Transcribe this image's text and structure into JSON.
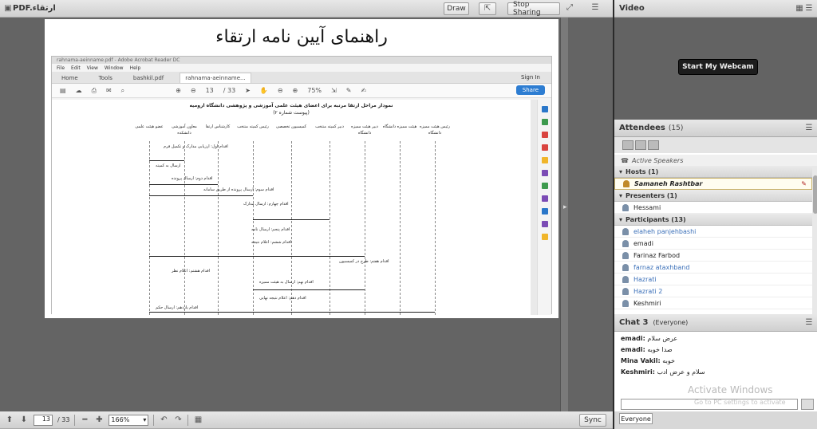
{
  "share": {
    "title": "PDF.ارتقاء",
    "draw_label": "Draw",
    "stop_label": "Stop Sharing",
    "slide_title": "راهنمای آیین نامه ارتقاء"
  },
  "reader": {
    "window_title": "rahnama-aeinname.pdf - Adobe Acrobat Reader DC",
    "menu": [
      "File",
      "Edit",
      "View",
      "Window",
      "Help"
    ],
    "tabs": [
      "Home",
      "Tools",
      "bashkil.pdf",
      "rahnama-aeinname..."
    ],
    "signin": "Sign In",
    "share_label": "Share",
    "page_current": "13",
    "page_total": "/ 33",
    "zoom": "75%",
    "doc_title": "نمودار مراحل ارتقا مرتبه برای اعضای هیئت علمی آموزشی و پژوهشی دانشگاه ارومیه",
    "doc_subtitle": "(پیوست شماره ۲)",
    "lanes": [
      "رئیس هیئت ممیزه دانشگاه",
      "هیئت ممیزه دانشگاه",
      "دبیر هیئت ممیزه دانشگاه",
      "دبیر کمیته منتخب",
      "کمیسیون تخصصی",
      "رئیس کمیته منتخب",
      "کارشناس ارتقا",
      "معاون آموزشی دانشکده",
      "عضو هیئت علمی"
    ],
    "steps": [
      "اقدام اول: ارزیابی مدارک و تکمیل فرم",
      "ارسال به کمیته",
      "اقدام دوم: ارسال پرونده",
      "اقدام سوم: ارسال پرونده از طریق سامانه",
      "اقدام چهارم: ارسال مدارک",
      "اقدام پنجم: ارسال نامه",
      "اقدام ششم: اعلام نتیجه",
      "اقدام هفتم: طرح در کمیسیون",
      "اقدام هشتم: اعلام نظر",
      "اقدام نهم: ارسال به هیئت ممیزه",
      "اقدام دهم: اعلام نتیجه نهایی",
      "اقدام یازدهم: ارسال حکم"
    ]
  },
  "bottom": {
    "page_value": "13",
    "page_total": "/ 33",
    "zoom_value": "166%",
    "sync_label": "Sync"
  },
  "video": {
    "title": "Video",
    "webcam_label": "Start My Webcam"
  },
  "attendees": {
    "title": "Attendees",
    "count": "(15)",
    "active_speakers": "Active Speakers",
    "hosts_label": "Hosts (1)",
    "hosts": [
      "Samaneh Rashtbar"
    ],
    "presenters_label": "Presenters (1)",
    "presenters": [
      "Hessami"
    ],
    "participants_label": "Participants (13)",
    "participants": [
      {
        "name": "elaheh panjehbashi",
        "blue": true
      },
      {
        "name": "emadi",
        "blue": false
      },
      {
        "name": "Farinaz Farbod",
        "blue": false
      },
      {
        "name": "farnaz ataxhband",
        "blue": true
      },
      {
        "name": "Hazrati",
        "blue": true
      },
      {
        "name": "Hazrati 2",
        "blue": true
      },
      {
        "name": "Keshmiri",
        "blue": false
      }
    ]
  },
  "chat": {
    "title": "Chat 3",
    "scope": "(Everyone)",
    "messages": [
      {
        "sender": "emadi:",
        "text": "عرض سلام"
      },
      {
        "sender": "emadi:",
        "text": "صدا خوبه"
      },
      {
        "sender": "Mina Vakil:",
        "text": "خوبه"
      },
      {
        "sender": "Keshmiri:",
        "text": "سلام و عرض ادب"
      }
    ],
    "tab_label": "Everyone",
    "activate_line1": "Activate Windows",
    "activate_line2": "Go to PC settings to activate"
  }
}
